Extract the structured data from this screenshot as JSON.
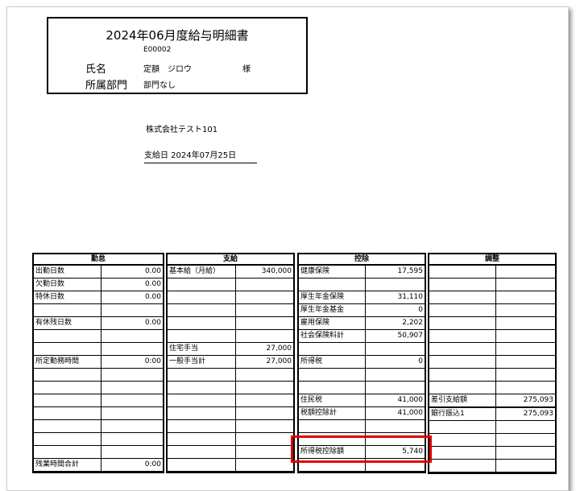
{
  "header": {
    "title": "2024年06月度給与明細書",
    "employee_id": "E00002",
    "name_label": "氏名",
    "name_value": "定額　ジロウ",
    "honorific": "様",
    "dept_label": "所属部門",
    "dept_value": "部門なし"
  },
  "company": "株式会社テスト101",
  "pay_date": "支給日 2024年07月25日",
  "kintai": {
    "title": "勤怠",
    "rows": [
      [
        "出勤日数",
        "0.00"
      ],
      [
        "欠勤日数",
        "0.00"
      ],
      [
        "特休日数",
        "0.00"
      ],
      [
        "",
        ""
      ],
      [
        "有休残日数",
        "0.00"
      ],
      [
        "",
        ""
      ],
      [
        "",
        ""
      ],
      [
        "所定勤務時間",
        "0:00"
      ],
      [
        "",
        ""
      ],
      [
        "",
        ""
      ],
      [
        "",
        ""
      ],
      [
        "",
        ""
      ],
      [
        "",
        ""
      ],
      [
        "",
        ""
      ],
      [
        "",
        ""
      ],
      [
        "残業時間合計",
        "0:00"
      ]
    ]
  },
  "shikyu": {
    "title": "支給",
    "rows": [
      [
        "基本給（月給）",
        "340,000"
      ],
      [
        "",
        ""
      ],
      [
        "",
        ""
      ],
      [
        "",
        ""
      ],
      [
        "",
        ""
      ],
      [
        "",
        ""
      ],
      [
        "住宅手当",
        "27,000"
      ],
      [
        "一般手当計",
        "27,000"
      ],
      [
        "",
        ""
      ],
      [
        "",
        ""
      ],
      [
        "",
        ""
      ],
      [
        "",
        ""
      ],
      [
        "",
        ""
      ],
      [
        "",
        ""
      ],
      [
        "",
        ""
      ],
      [
        "",
        ""
      ]
    ]
  },
  "koujo": {
    "title": "控除",
    "rows": [
      [
        "健康保険",
        "17,595"
      ],
      [
        "",
        ""
      ],
      [
        "厚生年金保険",
        "31,110"
      ],
      [
        "厚生年金基金",
        "0"
      ],
      [
        "雇用保険",
        "2,202"
      ],
      [
        "社会保険料計",
        "50,907"
      ],
      [
        "",
        ""
      ],
      [
        "所得税",
        "0"
      ],
      [
        "",
        ""
      ],
      [
        "",
        ""
      ],
      [
        "住民税",
        "41,000"
      ],
      [
        "税額控除計",
        "41,000"
      ],
      [
        "",
        ""
      ],
      [
        "",
        ""
      ],
      [
        "所得税控除額",
        "5,740"
      ],
      [
        "",
        ""
      ]
    ]
  },
  "chousei": {
    "title": "調整",
    "rows": [
      [
        "",
        ""
      ],
      [
        "",
        ""
      ],
      [
        "",
        ""
      ],
      [
        "",
        ""
      ],
      [
        "",
        ""
      ],
      [
        "",
        ""
      ],
      [
        "",
        ""
      ],
      [
        "",
        ""
      ],
      [
        "",
        ""
      ],
      [
        "",
        ""
      ],
      [
        "差引支給額",
        "275,093"
      ],
      [
        "銀行振込1",
        "275,093"
      ],
      [
        "",
        ""
      ],
      [
        "",
        ""
      ],
      [
        "",
        ""
      ],
      [
        "",
        ""
      ]
    ]
  },
  "colors": {
    "highlight": "#e00000",
    "border": "#000000"
  }
}
